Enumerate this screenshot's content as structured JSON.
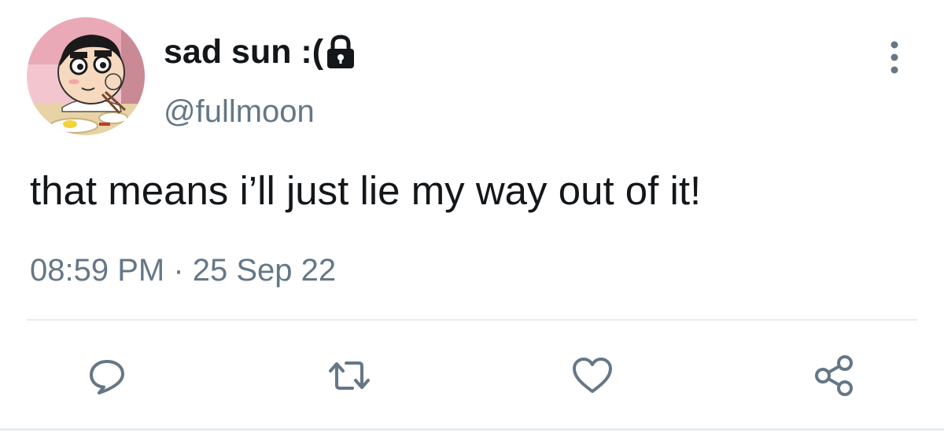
{
  "tweet": {
    "display_name": "sad sun :(",
    "handle": "@fullmoon",
    "text": "that means i’ll just lie my way out of it!",
    "timestamp": "08:59 PM · 25 Sep 22"
  },
  "icons": {
    "lock": "lock-icon",
    "more": "more-vertical-icon",
    "reply": "reply-icon",
    "retweet": "retweet-icon",
    "like": "heart-icon",
    "share": "share-icon"
  },
  "colors": {
    "text_primary": "#14171a",
    "text_secondary": "#657786",
    "icon": "#657786",
    "divider": "#e6ecf0"
  }
}
